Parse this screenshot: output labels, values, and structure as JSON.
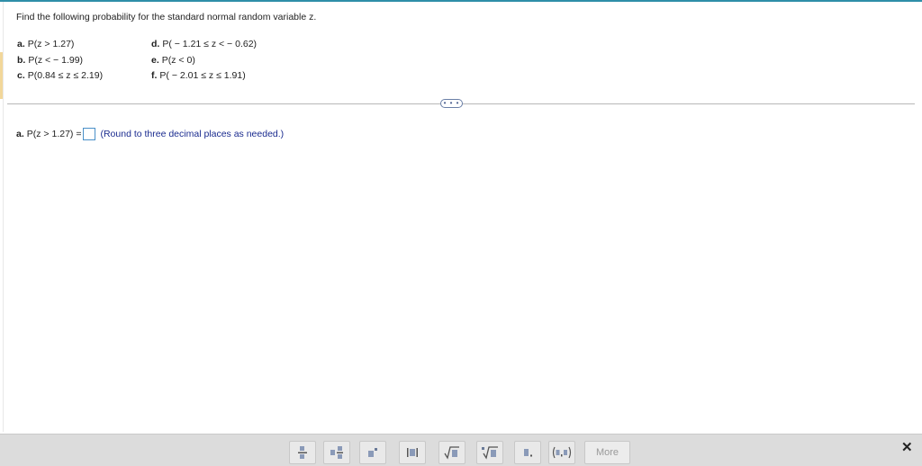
{
  "question": {
    "text": "Find the following probability for the standard normal random variable z."
  },
  "parts": [
    {
      "label": "a.",
      "expr": "P(z > 1.27)"
    },
    {
      "label": "b.",
      "expr": "P(z <  − 1.99)"
    },
    {
      "label": "c.",
      "expr": "P(0.84 ≤ z ≤ 2.19)"
    },
    {
      "label": "d.",
      "expr": "P( − 1.21 ≤ z <  − 0.62)"
    },
    {
      "label": "e.",
      "expr": "P(z < 0)"
    },
    {
      "label": "f.",
      "expr": "P( − 2.01 ≤ z ≤ 1.91)"
    }
  ],
  "expand_button": {
    "label": "• • •"
  },
  "answer": {
    "label": "a.",
    "expr": "P(z > 1.27) =",
    "value": "",
    "hint": "(Round to three decimal places as needed.)"
  },
  "toolbar": {
    "tools": [
      {
        "name": "fraction-tool-icon"
      },
      {
        "name": "mixed-number-tool-icon"
      },
      {
        "name": "exponent-tool-icon"
      },
      {
        "name": "absolute-value-tool-icon"
      },
      {
        "name": "square-root-tool-icon"
      },
      {
        "name": "nth-root-tool-icon"
      },
      {
        "name": "decimal-tool-icon"
      },
      {
        "name": "ordered-pair-tool-icon"
      }
    ],
    "more_label": "More",
    "close_label": "✕"
  },
  "colors": {
    "accent": "#2f8ea8",
    "hint_text": "#1a2b8f",
    "answer_box_border": "#4a90c8",
    "toolbar_bg": "#dcdcdc"
  }
}
